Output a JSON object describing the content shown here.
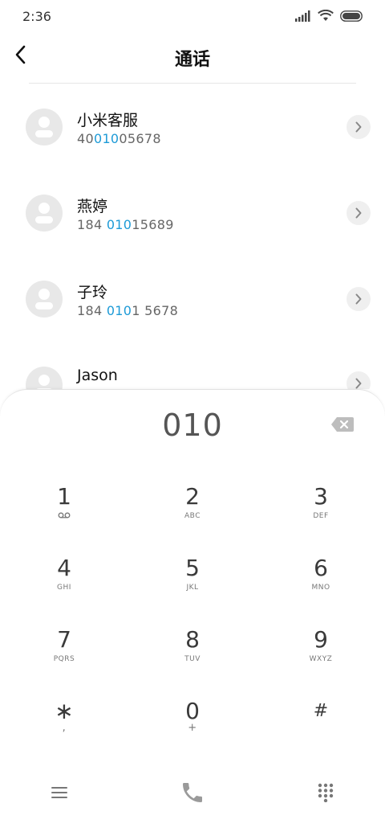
{
  "status": {
    "time": "2:36",
    "icons": [
      "signal-icon",
      "wifi-icon",
      "battery-icon"
    ]
  },
  "header": {
    "title": "通话",
    "back_icon": "chevron-left-icon"
  },
  "contacts": [
    {
      "name": "小米客服",
      "number_pre": "40",
      "number_hl": "010",
      "number_post": "05678"
    },
    {
      "name": "燕婷",
      "number_pre": "184 ",
      "number_hl": "010",
      "number_post": "15689"
    },
    {
      "name": "子玲",
      "number_pre": "184 ",
      "number_hl": "010",
      "number_post": "1 5678"
    },
    {
      "name": "Jason",
      "number_pre": "",
      "number_hl": "",
      "number_post": ""
    }
  ],
  "dialpad": {
    "dialed": "010",
    "keys": [
      {
        "digit": "1",
        "letters": "voicemail-icon"
      },
      {
        "digit": "2",
        "letters": "ABC"
      },
      {
        "digit": "3",
        "letters": "DEF"
      },
      {
        "digit": "4",
        "letters": "GHI"
      },
      {
        "digit": "5",
        "letters": "JKL"
      },
      {
        "digit": "6",
        "letters": "MNO"
      },
      {
        "digit": "7",
        "letters": "PQRS"
      },
      {
        "digit": "8",
        "letters": "TUV"
      },
      {
        "digit": "9",
        "letters": "WXYZ"
      },
      {
        "digit": "∗",
        "letters": ","
      },
      {
        "digit": "0",
        "letters": "+"
      },
      {
        "digit": "#",
        "letters": ""
      }
    ]
  },
  "bottom_bar": {
    "icons": [
      "menu-icon",
      "phone-call-icon",
      "dialpad-icon"
    ]
  },
  "colors": {
    "highlight": "#1e9bd7",
    "avatar_bg": "#e8e8e8",
    "text_secondary": "#666666"
  }
}
